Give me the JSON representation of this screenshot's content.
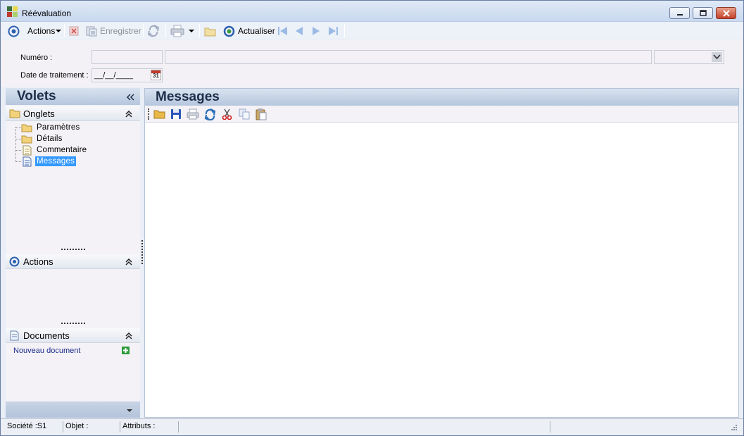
{
  "window": {
    "title": "Réévaluation"
  },
  "toolbar": {
    "actions_label": "Actions",
    "save_label": "Enregistrer",
    "refresh_label": "Actualiser"
  },
  "form": {
    "numero_label": "Numéro :",
    "date_label": "Date de traitement :",
    "date_placeholder": "__/__/____",
    "calendar_day": "31"
  },
  "left_pane": {
    "title": "Volets",
    "sections": {
      "onglets": {
        "title": "Onglets",
        "items": [
          "Paramètres",
          "Détails",
          "Commentaire",
          "Messages"
        ]
      },
      "actions": {
        "title": "Actions"
      },
      "documents": {
        "title": "Documents",
        "new_document": "Nouveau document"
      }
    }
  },
  "right_pane": {
    "title": "Messages"
  },
  "statusbar": {
    "societe": "Société :S1",
    "objet": "Objet :",
    "attributs": "Attributs :"
  },
  "colors": {
    "selection": "#3399ff",
    "header_text": "#1e2d48",
    "link": "#1a2a8a"
  },
  "icons": [
    "actions-circle-icon",
    "delete-icon",
    "save-icon",
    "refresh-icon",
    "print-icon",
    "folder-icon",
    "refresh-green-icon",
    "first-icon",
    "previous-icon",
    "next-icon",
    "last-icon",
    "calendar-icon",
    "folder-icon",
    "document-icon",
    "collapse-icon",
    "add-icon",
    "cut-icon",
    "copy-icon",
    "paste-icon"
  ]
}
